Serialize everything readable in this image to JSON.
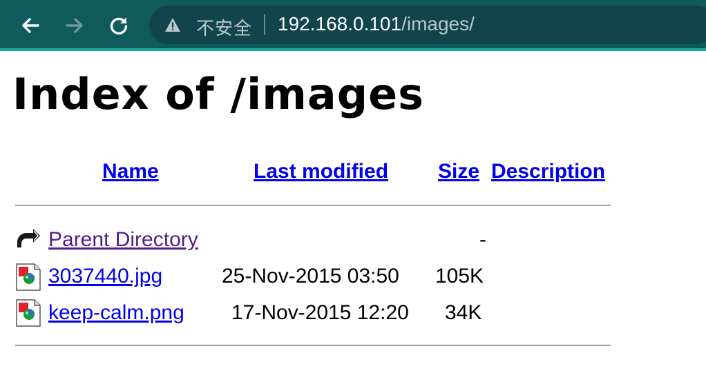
{
  "browser": {
    "security_text": "不安全",
    "url_host": "192.168.0.101",
    "url_path": "/images/",
    "colors": {
      "toolbar": "#0f5a5c",
      "accent": "#16a79c",
      "omnibox": "#11454b"
    }
  },
  "page": {
    "title": "Index of /images",
    "columns": {
      "name": "Name",
      "modified": "Last modified",
      "size": "Size",
      "description": "Description"
    },
    "rows": [
      {
        "icon": "back-icon",
        "name": "Parent Directory",
        "modified": "",
        "size": "-",
        "description": ""
      },
      {
        "icon": "image-file-icon",
        "name": "3037440.jpg",
        "modified": "25-Nov-2015 03:50",
        "size": "105K",
        "description": ""
      },
      {
        "icon": "image-file-icon",
        "name": "keep-calm.png",
        "modified": "17-Nov-2015 12:20",
        "size": "34K",
        "description": ""
      }
    ]
  }
}
